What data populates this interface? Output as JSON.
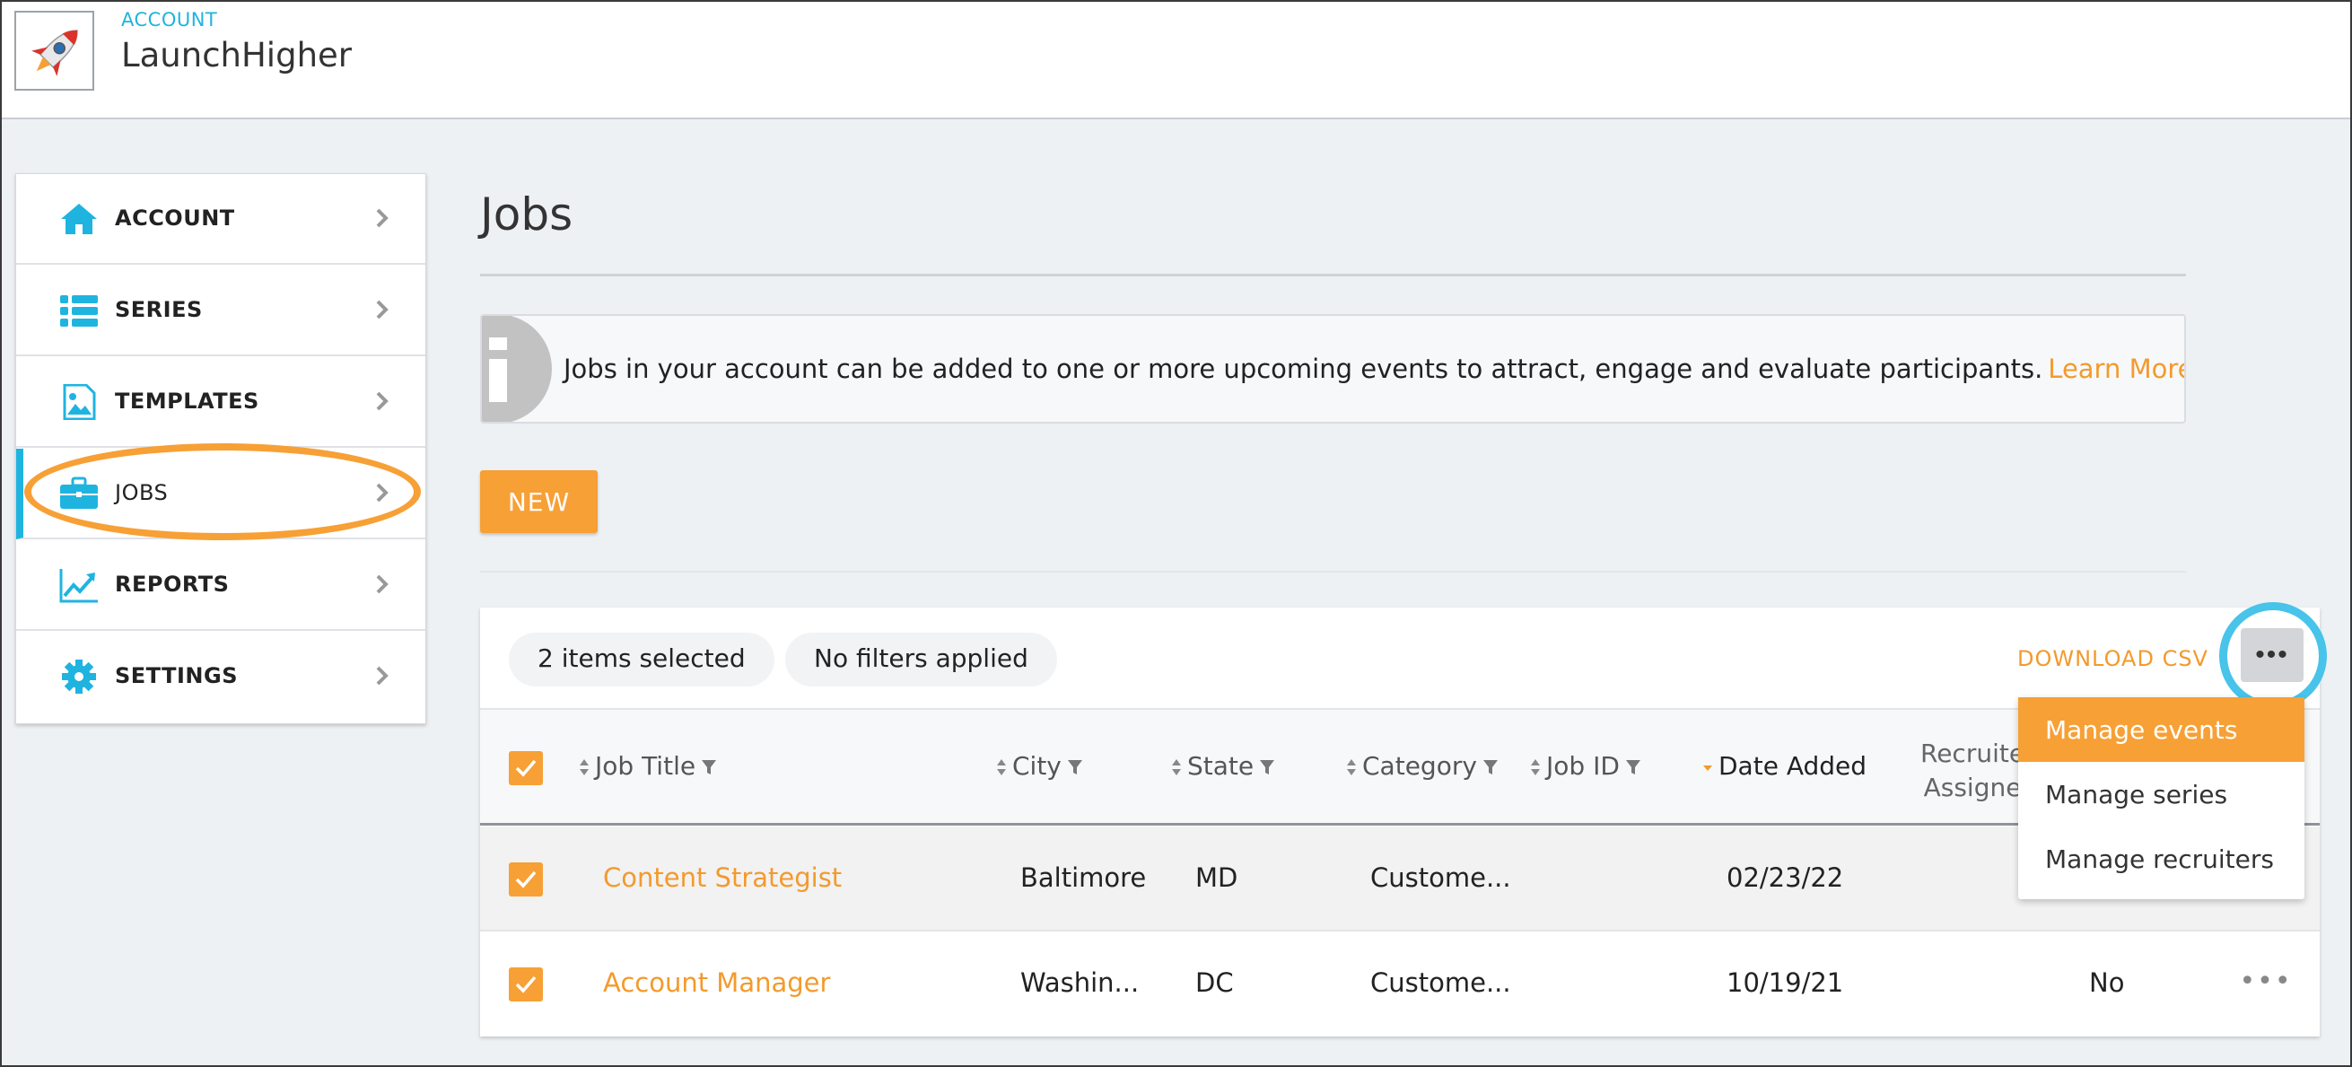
{
  "header": {
    "subtitle": "ACCOUNT",
    "title": "LaunchHigher",
    "logo_icon": "rocket-icon"
  },
  "sidebar": {
    "items": [
      {
        "label": "ACCOUNT",
        "icon": "home-icon"
      },
      {
        "label": "SERIES",
        "icon": "list-icon"
      },
      {
        "label": "TEMPLATES",
        "icon": "image-icon"
      },
      {
        "label": "JOBS",
        "icon": "briefcase-icon",
        "active": true
      },
      {
        "label": "REPORTS",
        "icon": "chart-icon"
      },
      {
        "label": "SETTINGS",
        "icon": "gear-icon"
      }
    ]
  },
  "main": {
    "title": "Jobs",
    "info": {
      "text": "Jobs in your account can be added to one or more upcoming events to attract, engage and evaluate participants.",
      "link": "Learn More"
    },
    "new_label": "NEW"
  },
  "table": {
    "toolbar": {
      "selected": "2 items selected",
      "filters": "No filters applied",
      "download": "DOWNLOAD CSV"
    },
    "columns": {
      "job_title": "Job Title",
      "city": "City",
      "state": "State",
      "category": "Category",
      "job_id": "Job ID",
      "date_added": "Date Added",
      "recruiter_line1": "Recruite",
      "recruiter_line2": "Assigne"
    },
    "rows": [
      {
        "title": "Content Strategist",
        "city": "Baltimore",
        "state": "MD",
        "category": "Custome...",
        "job_id": "",
        "date": "02/23/22",
        "recruiter": ""
      },
      {
        "title": "Account Manager",
        "city": "Washin...",
        "state": "DC",
        "category": "Custome...",
        "job_id": "",
        "date": "10/19/21",
        "recruiter": "No"
      }
    ]
  },
  "dropdown": {
    "items": [
      "Manage events",
      "Manage series",
      "Manage recruiters"
    ]
  },
  "colors": {
    "accent": "#f7a035",
    "highlight_blue": "#48c3ea",
    "icon_blue": "#1fb4e0"
  }
}
